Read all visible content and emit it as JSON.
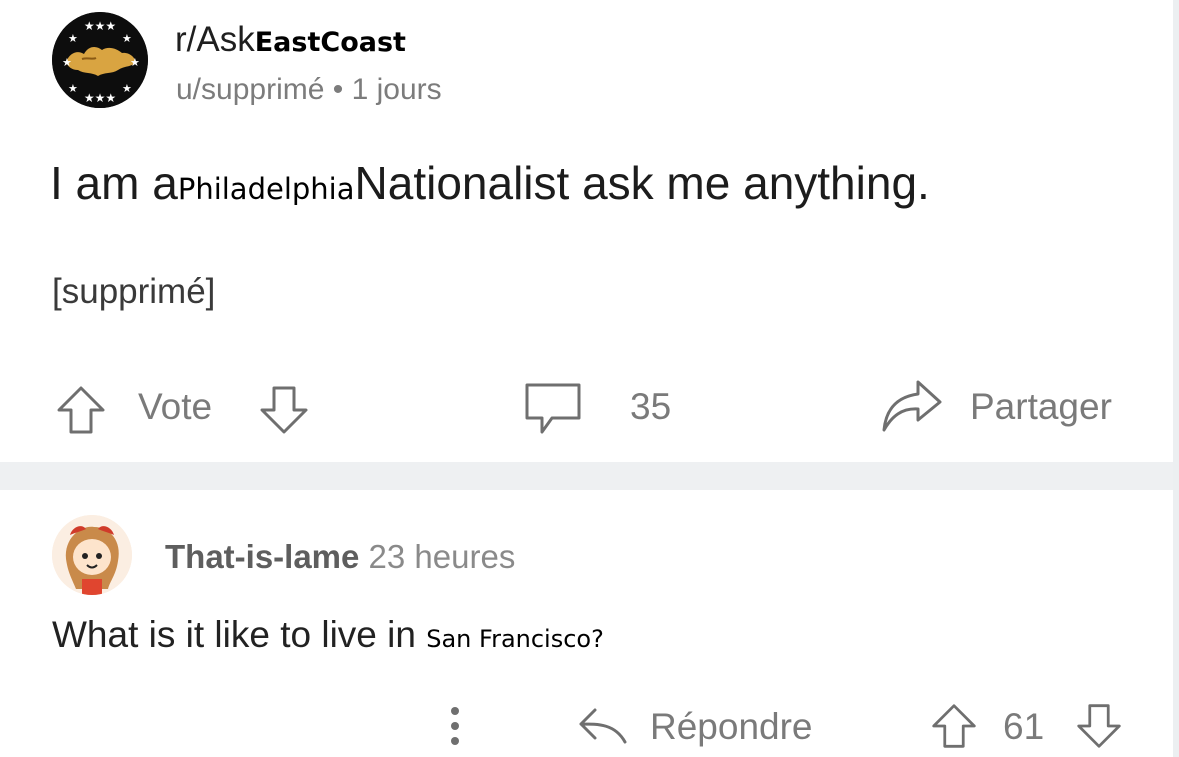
{
  "post": {
    "subreddit_prefix": "r/Ask",
    "subreddit_suffix": "EastCoast",
    "meta": "u/supprimé • 1 jours",
    "title_start": "I am a",
    "title_insert": "Philadelphia",
    "title_end": "Nationalist ask me anything.",
    "body": "[supprimé]",
    "vote_label": "Vote",
    "comment_count": "35",
    "share_label": "Partager"
  },
  "comment": {
    "username": "That-is-lame",
    "time": "23 heures",
    "text_start": "What is it like to live in",
    "text_insert": "San Francisco?",
    "reply_label": "Répondre",
    "score": "61"
  },
  "icons": {
    "subreddit_avatar": "subreddit-avatar",
    "upvote": "upvote-arrow-icon",
    "downvote": "downvote-arrow-icon",
    "comments": "comment-bubble-icon",
    "share": "share-arrow-icon",
    "more": "more-vertical-icon",
    "reply": "reply-arrow-icon"
  },
  "colors": {
    "text": "#1c1c1c",
    "muted": "#7a7a7a",
    "divider": "#eef0f2"
  }
}
